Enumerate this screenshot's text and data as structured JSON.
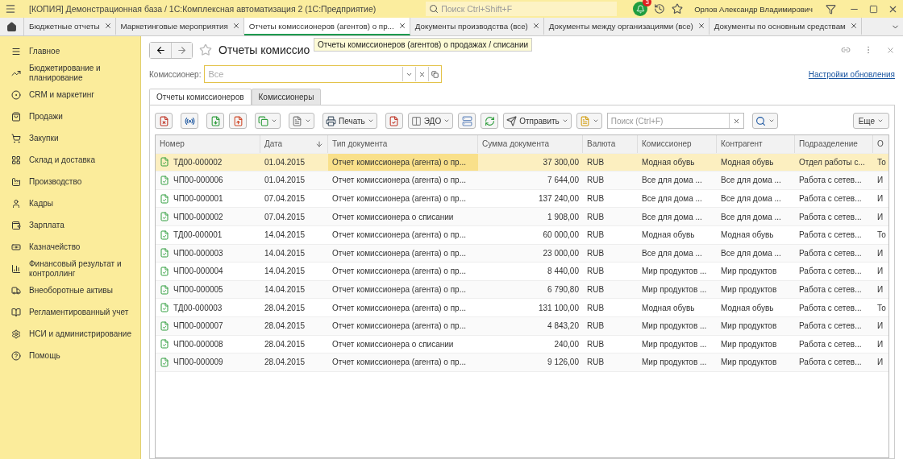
{
  "window": {
    "title": "[КОПИЯ] Демонстрационная база / 1С:Комплексная автоматизация 2  (1С:Предприятие)",
    "search_placeholder": "Поиск Ctrl+Shift+F",
    "notifications": "3",
    "user": "Орлов Александр Владимирович"
  },
  "tabs": [
    {
      "label": "Бюджетные отчеты",
      "selected": false
    },
    {
      "label": "Маркетинговые мероприятия",
      "selected": false
    },
    {
      "label": "Отчеты комиссионеров (агентов) о пр...",
      "selected": true
    },
    {
      "label": "Документы производства (все)",
      "selected": false
    },
    {
      "label": "Документы между организациями (все)",
      "selected": false
    },
    {
      "label": "Документы по основным средствам",
      "selected": false
    }
  ],
  "sidebar": {
    "items": [
      {
        "label": "Главное"
      },
      {
        "label": "Бюджетирование и планирование"
      },
      {
        "label": "CRM и маркетинг"
      },
      {
        "label": "Продажи"
      },
      {
        "label": "Закупки"
      },
      {
        "label": "Склад и доставка"
      },
      {
        "label": "Производство"
      },
      {
        "label": "Кадры"
      },
      {
        "label": "Зарплата"
      },
      {
        "label": "Казначейство"
      },
      {
        "label": "Финансовый результат и контроллинг"
      },
      {
        "label": "Внеоборотные активы"
      },
      {
        "label": "Регламентированный учет"
      },
      {
        "label": "НСИ и администрирование"
      },
      {
        "label": "Помощь"
      }
    ]
  },
  "form": {
    "title": "Отчеты комиссио",
    "tooltip": "Отчеты комиссионеров (агентов) о продажах / списании",
    "filter_label": "Комиссионер:",
    "filter_placeholder": "Все",
    "update_link": "Настройки обновления",
    "tabs": [
      {
        "label": "Отчеты комиссионеров",
        "selected": true
      },
      {
        "label": "Комиссионеры",
        "selected": false
      }
    ],
    "toolbar": {
      "print": "Печать",
      "edo": "ЭДО",
      "send": "Отправить",
      "search_placeholder": "Поиск (Ctrl+F)",
      "more": "Еще"
    }
  },
  "table": {
    "columns": [
      "Номер",
      "Дата",
      "Тип документа",
      "Сумма документа",
      "Валюта",
      "Комиссионер",
      "Контрагент",
      "Подразделение",
      "О"
    ],
    "rows": [
      {
        "selected": true,
        "cells": [
          "ТД00-000002",
          "01.04.2015",
          "Отчет комиссионера (агента) о пр...",
          "37 300,00",
          "RUB",
          "Модная обувь",
          "Модная обувь",
          "Отдел работы с...",
          "То"
        ]
      },
      {
        "selected": false,
        "cells": [
          "ЧП00-000006",
          "01.04.2015",
          "Отчет комиссионера (агента) о пр...",
          "7 644,00",
          "RUB",
          "Все для дома ...",
          "Все для дома ...",
          "Работа с сетев...",
          "И"
        ]
      },
      {
        "selected": false,
        "cells": [
          "ЧП00-000001",
          "07.04.2015",
          "Отчет комиссионера (агента) о пр...",
          "137 240,00",
          "RUB",
          "Все для дома ...",
          "Все для дома ...",
          "Работа с сетев...",
          "И"
        ]
      },
      {
        "selected": false,
        "cells": [
          "ЧП00-000002",
          "07.04.2015",
          "Отчет комиссионера о списании",
          "1 908,00",
          "RUB",
          "Все для дома ...",
          "Все для дома ...",
          "Работа с сетев...",
          "И"
        ]
      },
      {
        "selected": false,
        "cells": [
          "ТД00-000001",
          "14.04.2015",
          "Отчет комиссионера (агента) о пр...",
          "60 000,00",
          "RUB",
          "Модная обувь",
          "Модная обувь",
          "Работа с сетев...",
          "То"
        ]
      },
      {
        "selected": false,
        "cells": [
          "ЧП00-000003",
          "14.04.2015",
          "Отчет комиссионера (агента) о пр...",
          "23 000,00",
          "RUB",
          "Все для дома ...",
          "Все для дома ...",
          "Работа с сетев...",
          "И"
        ]
      },
      {
        "selected": false,
        "cells": [
          "ЧП00-000004",
          "14.04.2015",
          "Отчет комиссионера (агента) о пр...",
          "8 440,00",
          "RUB",
          "Мир продуктов ...",
          "Мир продуктов",
          "Работа с сетев...",
          "И"
        ]
      },
      {
        "selected": false,
        "cells": [
          "ЧП00-000005",
          "14.04.2015",
          "Отчет комиссионера (агента) о пр...",
          "6 790,80",
          "RUB",
          "Мир продуктов ...",
          "Мир продуктов",
          "Работа с сетев...",
          "И"
        ]
      },
      {
        "selected": false,
        "cells": [
          "ТД00-000003",
          "28.04.2015",
          "Отчет комиссионера (агента) о пр...",
          "131 100,00",
          "RUB",
          "Модная обувь",
          "Модная обувь",
          "Работа с сетев...",
          "То"
        ]
      },
      {
        "selected": false,
        "cells": [
          "ЧП00-000007",
          "28.04.2015",
          "Отчет комиссионера (агента) о пр...",
          "4 843,20",
          "RUB",
          "Мир продуктов ...",
          "Мир продуктов",
          "Работа с сетев...",
          "И"
        ]
      },
      {
        "selected": false,
        "cells": [
          "ЧП00-000008",
          "28.04.2015",
          "Отчет комиссионера о списании",
          "240,00",
          "RUB",
          "Мир продуктов ...",
          "Мир продуктов",
          "Работа с сетев...",
          "И"
        ]
      },
      {
        "selected": false,
        "cells": [
          "ЧП00-000009",
          "28.04.2015",
          "Отчет комиссионера (агента) о пр...",
          "9 126,00",
          "RUB",
          "Мир продуктов ...",
          "Мир продуктов",
          "Работа с сетев...",
          "И"
        ]
      }
    ]
  }
}
